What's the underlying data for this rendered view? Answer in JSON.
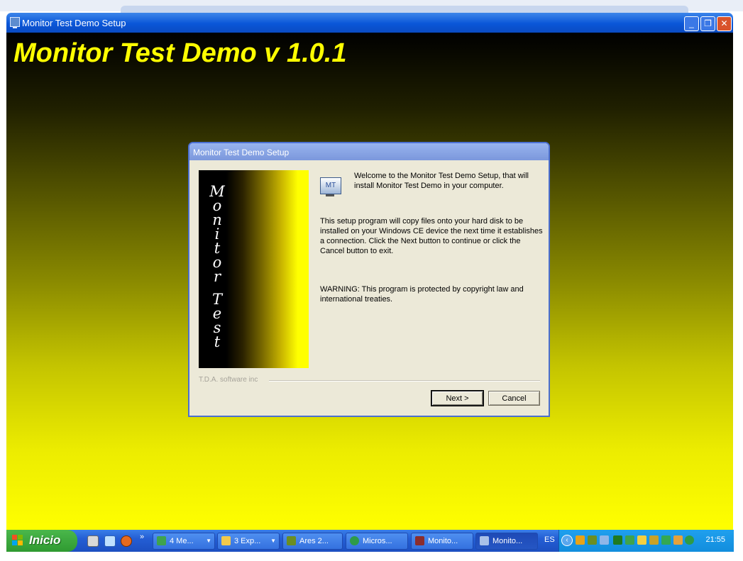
{
  "window": {
    "title": "Monitor Test Demo Setup",
    "minimize_glyph": "_",
    "restore_glyph": "❐",
    "close_glyph": "✕"
  },
  "installer": {
    "heading": "Monitor Test Demo v 1.0.1"
  },
  "dialog": {
    "title": "Monitor Test Demo Setup",
    "banner_letters_line1": [
      "M",
      "o",
      "n",
      "i",
      "t",
      "o",
      "r"
    ],
    "banner_letters_line2": [
      "T",
      "e",
      "s",
      "t"
    ],
    "icon_label": "MT",
    "welcome_text": "Welcome to the Monitor Test Demo Setup, that will install Monitor Test Demo in your computer.",
    "body_text": "This setup program will copy files onto your hard disk to be installed on your Windows CE device the next time it establishes a connection.  Click the Next button to continue or click the Cancel button to exit.",
    "warning_text": "WARNING: This program is protected by copyright law and international treaties.",
    "brand": "T.D.A. software inc",
    "next_label": "Next >",
    "cancel_label": "Cancel"
  },
  "taskbar": {
    "start_label": "Inicio",
    "overflow_glyph": "»",
    "tasks": [
      {
        "label": "4 Me...",
        "icon": "messenger-icon",
        "color": "#3fa34d",
        "grouped": true
      },
      {
        "label": "3 Exp...",
        "icon": "folder-icon",
        "color": "#f2c94c",
        "grouped": true
      },
      {
        "label": "Ares 2...",
        "icon": "ares-icon",
        "color": "#6b8e23",
        "grouped": false
      },
      {
        "label": "Micros...",
        "icon": "activesync-icon",
        "color": "#2e9b47",
        "grouped": false
      },
      {
        "label": "Monito...",
        "icon": "winrar-icon",
        "color": "#8b2d2d",
        "grouped": false
      },
      {
        "label": "Monito...",
        "icon": "monitor-test-icon",
        "color": "#a9c1e8",
        "grouped": false
      }
    ],
    "language": "ES",
    "tray_toggle_glyph": "‹",
    "clock": "21:55"
  },
  "colors": {
    "installer_title": "#ffff00",
    "gradient_top": "#000000",
    "gradient_bottom": "#ffff00",
    "dialog_bg": "#ece9d8",
    "xp_title_blue": "#0a56d8",
    "start_green": "#3a9e3b"
  }
}
